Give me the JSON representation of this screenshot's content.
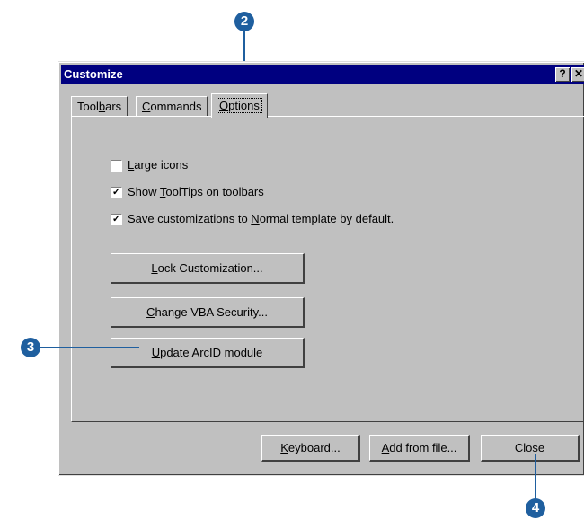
{
  "window": {
    "title": "Customize",
    "help_glyph": "?",
    "close_glyph": "✕"
  },
  "tabs": [
    {
      "pre": "Tool",
      "ul": "b",
      "post": "ars"
    },
    {
      "pre": "",
      "ul": "C",
      "post": "ommands"
    },
    {
      "pre": "",
      "ul": "O",
      "post": "ptions"
    }
  ],
  "options": {
    "large_icons": {
      "pre": "",
      "ul": "L",
      "post": "arge icons",
      "checked": false
    },
    "tooltips": {
      "pre": "Show ",
      "ul": "T",
      "post": "oolTips on toolbars",
      "checked": true
    },
    "save_custom": {
      "pre": "Save customizations to ",
      "ul": "N",
      "post": "ormal template by default.",
      "checked": true
    }
  },
  "buttons": {
    "lock": {
      "pre": "",
      "ul": "L",
      "post": "ock Customization..."
    },
    "vba": {
      "pre": "",
      "ul": "C",
      "post": "hange VBA Security..."
    },
    "arcid": {
      "pre": "",
      "ul": "U",
      "post": "pdate ArcID module"
    },
    "keyboard": {
      "pre": "",
      "ul": "K",
      "post": "eyboard..."
    },
    "add_file": {
      "pre": "",
      "ul": "A",
      "post": "dd from file..."
    },
    "close": "Close"
  },
  "callouts": {
    "c2": "2",
    "c3": "3",
    "c4": "4"
  },
  "check_glyph": "✓",
  "colors": {
    "titlebar": "#000080",
    "callout": "#1f5f9f",
    "face": "#c0c0c0"
  }
}
